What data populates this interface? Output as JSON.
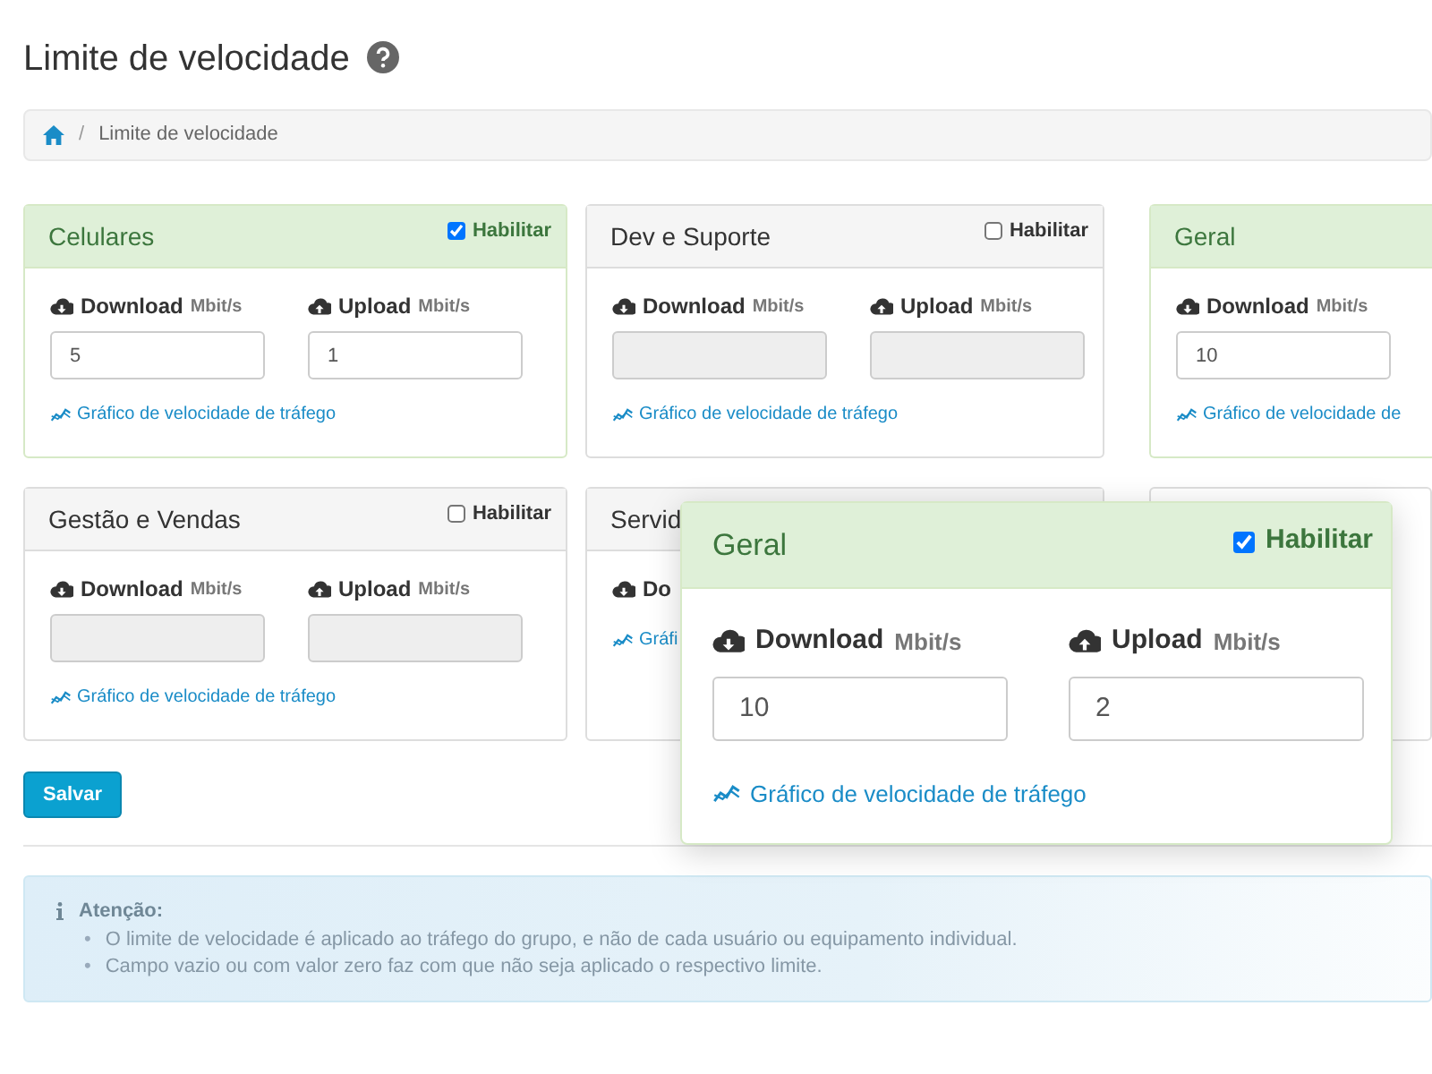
{
  "page_title": "Limite de velocidade",
  "breadcrumb": [
    {
      "kind": "home"
    },
    {
      "kind": "separator",
      "label": "/"
    },
    {
      "kind": "text",
      "label": "Limite de velocidade"
    }
  ],
  "cards": [
    {
      "kind": "full",
      "title": "Celulares",
      "enabled": true,
      "toggle_label": "Habilitar",
      "download": {
        "label": "Download",
        "unit": "Mbit/s",
        "value": "5"
      },
      "upload": {
        "label": "Upload",
        "unit": "Mbit/s",
        "value": "1"
      },
      "link": "Gráfico de velocidade de tráfego"
    },
    {
      "kind": "full",
      "title": "Dev e Suporte",
      "enabled": false,
      "toggle_label": "Habilitar",
      "download": {
        "label": "Download",
        "unit": "Mbit/s"
      },
      "upload": {
        "label": "Upload",
        "unit": "Mbit/s"
      },
      "link": "Gráfico de velocidade de tráfego"
    },
    {
      "kind": "partial",
      "title": "Geral",
      "enabled": true,
      "download": {
        "label": "Download",
        "unit": "Mbit/s",
        "value": "10"
      },
      "link": "Gráfico de velocidade de"
    },
    {
      "kind": "full",
      "title": "Gestão e Vendas",
      "enabled": false,
      "toggle_label": "Habilitar",
      "download": {
        "label": "Download",
        "unit": "Mbit/s"
      },
      "upload": {
        "label": "Upload",
        "unit": "Mbit/s"
      },
      "link": "Gráfico de velocidade de tráfego"
    },
    {
      "kind": "covered",
      "title": "Servid",
      "enabled": false,
      "download": {
        "label": "Do"
      },
      "link": "Gráfi"
    },
    {
      "kind": "blank"
    }
  ],
  "save_button": "Salvar",
  "popup": {
    "title": "Geral",
    "enabled": true,
    "toggle_label": "Habilitar",
    "download": {
      "label": "Download",
      "unit": "Mbit/s",
      "value": "10"
    },
    "upload": {
      "label": "Upload",
      "unit": "Mbit/s",
      "value": "2"
    },
    "link": "Gráfico de velocidade de tráfego"
  },
  "notice": {
    "title": "Atenção:",
    "items": [
      {
        "marker": "•",
        "text": "O limite de velocidade é aplicado ao tráfego do grupo, e não de cada usuário ou equipamento individual."
      },
      {
        "marker": "•",
        "text": "Campo vazio ou com valor zero faz com que não seja aplicado o respectivo limite."
      }
    ]
  }
}
